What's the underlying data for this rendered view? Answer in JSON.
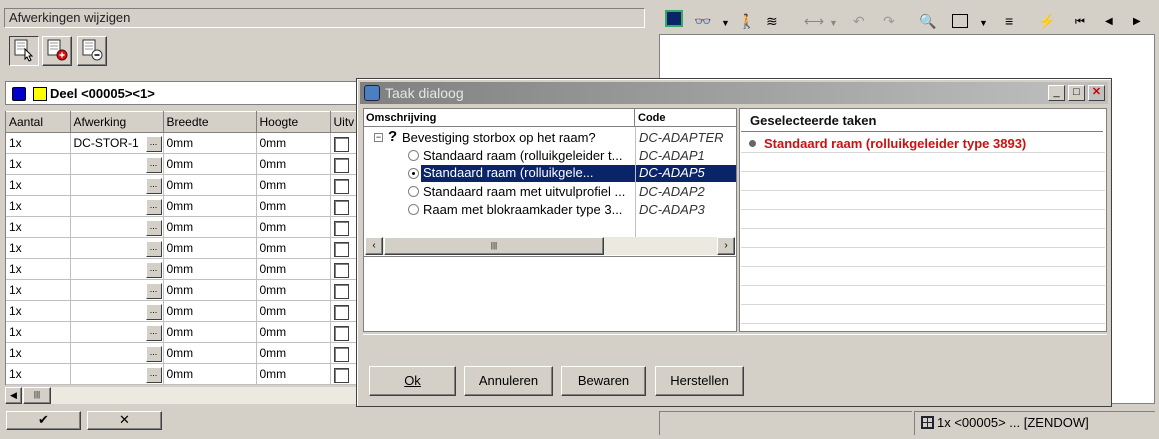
{
  "left": {
    "title": "Afwerkingen wijzigen",
    "deel_label": "Deel <00005><1>",
    "columns": [
      "Aantal",
      "Afwerking",
      "Breedte",
      "Hoogte",
      "Uitv"
    ],
    "rows": [
      {
        "aantal": "1x",
        "afwerking": "DC-STOR-1",
        "breedte": "0mm",
        "hoogte": "0mm"
      },
      {
        "aantal": "1x",
        "afwerking": "",
        "breedte": "0mm",
        "hoogte": "0mm"
      },
      {
        "aantal": "1x",
        "afwerking": "",
        "breedte": "0mm",
        "hoogte": "0mm"
      },
      {
        "aantal": "1x",
        "afwerking": "",
        "breedte": "0mm",
        "hoogte": "0mm"
      },
      {
        "aantal": "1x",
        "afwerking": "",
        "breedte": "0mm",
        "hoogte": "0mm"
      },
      {
        "aantal": "1x",
        "afwerking": "",
        "breedte": "0mm",
        "hoogte": "0mm"
      },
      {
        "aantal": "1x",
        "afwerking": "",
        "breedte": "0mm",
        "hoogte": "0mm"
      },
      {
        "aantal": "1x",
        "afwerking": "",
        "breedte": "0mm",
        "hoogte": "0mm"
      },
      {
        "aantal": "1x",
        "afwerking": "",
        "breedte": "0mm",
        "hoogte": "0mm"
      },
      {
        "aantal": "1x",
        "afwerking": "",
        "breedte": "0mm",
        "hoogte": "0mm"
      },
      {
        "aantal": "1x",
        "afwerking": "",
        "breedte": "0mm",
        "hoogte": "0mm"
      },
      {
        "aantal": "1x",
        "afwerking": "",
        "breedte": "0mm",
        "hoogte": "0mm"
      }
    ],
    "ellipsis": "...",
    "ok_symbol": "✔",
    "cancel_symbol": "✕"
  },
  "dialog": {
    "title": "Taak dialoog",
    "col_desc": "Omschrijving",
    "col_code": "Code",
    "tree": [
      {
        "label": "Bevestiging storbox op het raam?",
        "code": "DC-ADAPTER"
      },
      {
        "label": "Standaard raam (rolluikgeleider t...",
        "code": "DC-ADAP1"
      },
      {
        "label": "Standaard raam (rolluikgele...",
        "code": "DC-ADAP5"
      },
      {
        "label": "Standaard raam met uitvulprofiel ...",
        "code": "DC-ADAP2"
      },
      {
        "label": "Raam met blokraamkader type 3...",
        "code": "DC-ADAP3"
      }
    ],
    "selected_header": "Geselecteerde taken",
    "selected_item": "Standaard raam (rolluikgeleider type 3893)",
    "buttons": {
      "ok": "Ok",
      "annuleren": "Annuleren",
      "bewaren": "Bewaren",
      "herstellen": "Herstellen"
    }
  },
  "status": {
    "right_text": "1x <00005> ... [ZENDOW]"
  },
  "colors": {
    "selection": "#0a246a",
    "selected_text": "#cc1010",
    "deel_blue": "#0000cc",
    "deel_yellow": "#ffff00"
  }
}
